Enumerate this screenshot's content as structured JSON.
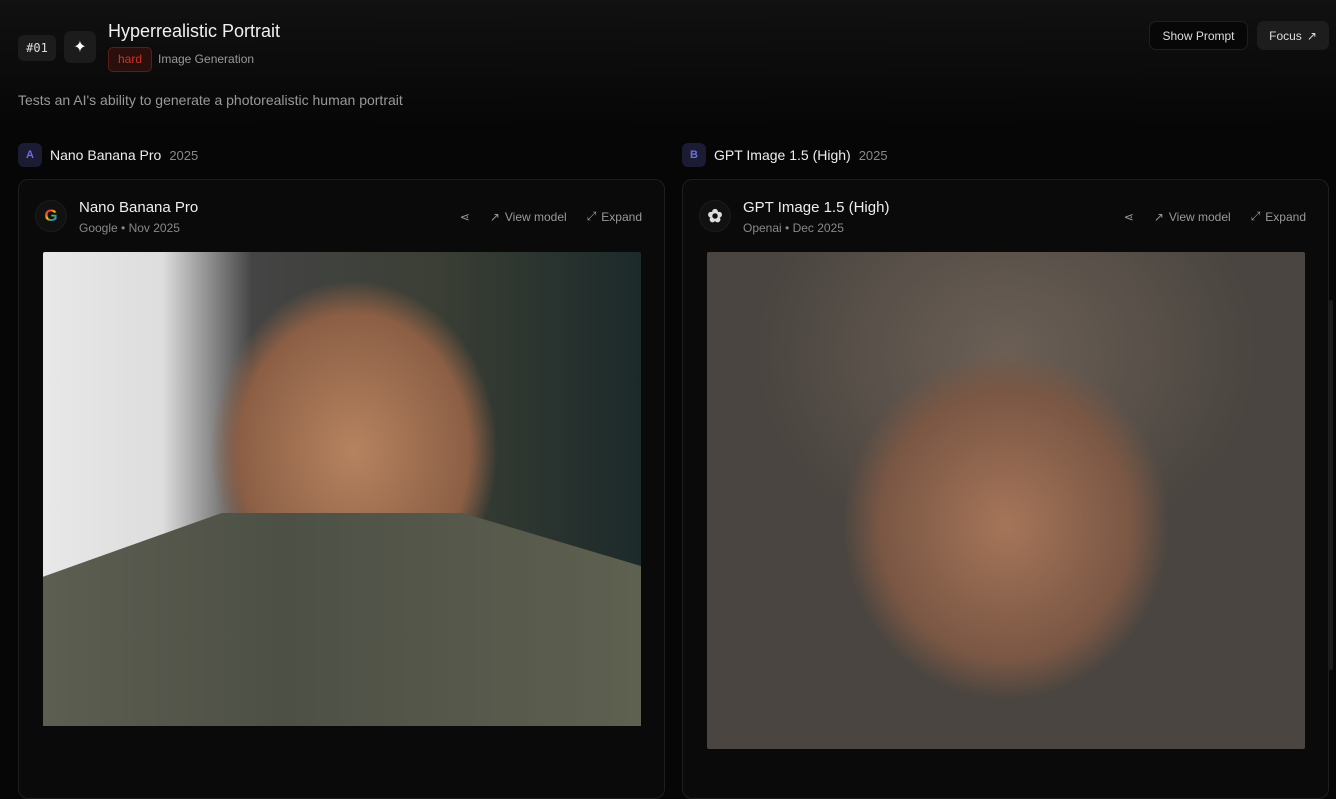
{
  "header": {
    "number": "#01",
    "title": "Hyperrealistic Portrait",
    "difficulty": "hard",
    "category": "Image Generation",
    "description": "Tests an AI's ability to generate a photorealistic human portrait",
    "show_prompt": "Show Prompt",
    "focus": "Focus"
  },
  "columns": [
    {
      "letter": "A",
      "name": "Nano Banana Pro",
      "year": "2025",
      "model": "Nano Banana Pro",
      "meta": "Google • Nov 2025",
      "view_model": "View model",
      "expand": "Expand"
    },
    {
      "letter": "B",
      "name": "GPT Image 1.5 (High)",
      "year": "2025",
      "model": "GPT Image 1.5 (High)",
      "meta": "Openai • Dec 2025",
      "view_model": "View model",
      "expand": "Expand"
    }
  ]
}
